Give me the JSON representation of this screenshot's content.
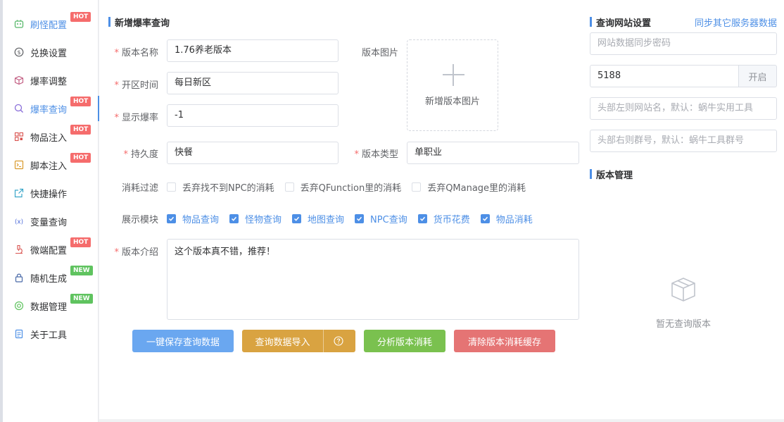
{
  "sidebar": {
    "items": [
      {
        "label": "刷怪配置",
        "icon": "monster-icon",
        "tag": "HOT",
        "active": false
      },
      {
        "label": "兑换设置",
        "icon": "exchange-icon",
        "tag": "",
        "active": false
      },
      {
        "label": "爆率调整",
        "icon": "box-icon",
        "tag": "",
        "active": false
      },
      {
        "label": "爆率查询",
        "icon": "search-icon",
        "tag": "HOT",
        "active": true
      },
      {
        "label": "物品注入",
        "icon": "qrcode-icon",
        "tag": "HOT",
        "active": false
      },
      {
        "label": "脚本注入",
        "icon": "script-icon",
        "tag": "HOT",
        "active": false
      },
      {
        "label": "快捷操作",
        "icon": "external-link-icon",
        "tag": "",
        "active": false
      },
      {
        "label": "变量查询",
        "icon": "variable-icon",
        "tag": "",
        "active": false
      },
      {
        "label": "微端配置",
        "icon": "microscope-icon",
        "tag": "HOT",
        "active": false
      },
      {
        "label": "随机生成",
        "icon": "lock-icon",
        "tag": "NEW",
        "active": false
      },
      {
        "label": "数据管理",
        "icon": "data-icon",
        "tag": "NEW",
        "active": false
      },
      {
        "label": "关于工具",
        "icon": "document-icon",
        "tag": "",
        "active": false
      }
    ]
  },
  "form": {
    "title": "新增爆率查询",
    "version_name": {
      "label": "版本名称",
      "value": "1.76养老版本"
    },
    "open_time": {
      "label": "开区时间",
      "value": "每日新区"
    },
    "display_rate": {
      "label": "显示爆率",
      "value": "-1"
    },
    "durability": {
      "label": "持久度",
      "value": "快餐"
    },
    "version_type": {
      "label": "版本类型",
      "value": "单职业"
    },
    "version_image": {
      "label": "版本图片",
      "upload_text": "新增版本图片"
    },
    "consume_filter": {
      "label": "消耗过滤",
      "options": [
        {
          "label": "丢弃找不到NPC的消耗",
          "checked": false
        },
        {
          "label": "丢弃QFunction里的消耗",
          "checked": false
        },
        {
          "label": "丢弃QManage里的消耗",
          "checked": false
        }
      ]
    },
    "display_modules": {
      "label": "展示模块",
      "options": [
        {
          "label": "物品查询",
          "checked": true
        },
        {
          "label": "怪物查询",
          "checked": true
        },
        {
          "label": "地图查询",
          "checked": true
        },
        {
          "label": "NPC查询",
          "checked": true
        },
        {
          "label": "货币花费",
          "checked": true
        },
        {
          "label": "物品消耗",
          "checked": true
        }
      ]
    },
    "intro": {
      "label": "版本介绍",
      "value": "这个版本真不错，推荐！"
    },
    "buttons": {
      "save": "一键保存查询数据",
      "import": "查询数据导入",
      "analyze": "分析版本消耗",
      "clear": "清除版本消耗缓存"
    }
  },
  "site_settings": {
    "title": "查询网站设置",
    "sync_link": "同步其它服务器数据",
    "sync_password_placeholder": "网站数据同步密码",
    "port_value": "5188",
    "open_button": "开启",
    "left_name_placeholder": "头部左则网站名，默认：蜗牛实用工具",
    "right_group_placeholder": "头部右则群号，默认：蜗牛工具群号"
  },
  "version_management": {
    "title": "版本管理",
    "empty_text": "暂无查询版本"
  },
  "colors": {
    "accent": "#4d8fe6",
    "hot": "#f56c6c",
    "new": "#5fc35f"
  }
}
